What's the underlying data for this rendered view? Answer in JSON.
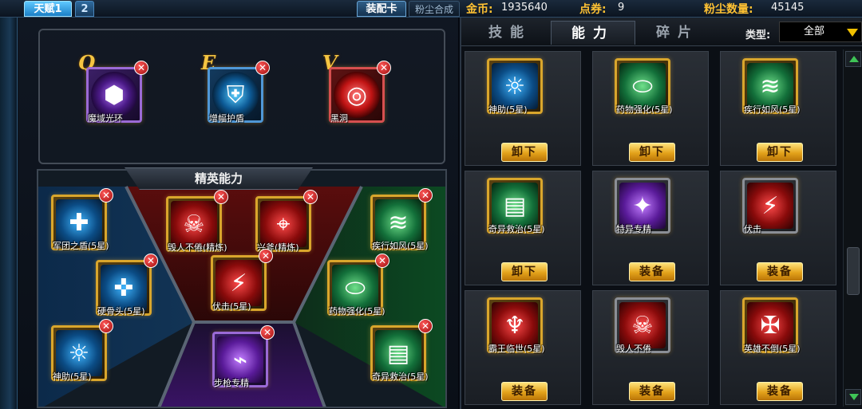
{
  "topbar": {
    "talent_tab_1": "天赋1",
    "talent_tab_2": "2",
    "equip_card_tab": "装配卡",
    "dust_synth_tab": "粉尘合成",
    "gold_label": "金币:",
    "gold_value": "1935640",
    "voucher_label": "点券:",
    "voucher_value": "9",
    "dust_label": "粉尘数量:",
    "dust_value": "45145"
  },
  "hotkeys": [
    {
      "key": "Q",
      "label": "魔域光环",
      "icon": "hexagon-stack-icon",
      "color": "#7b3bd6"
    },
    {
      "key": "E",
      "label": "增幅护盾",
      "icon": "shield-sword-icon",
      "color": "#1f8fd6"
    },
    {
      "key": "V",
      "label": "黑洞",
      "icon": "vortex-icon",
      "color": "#e01f1f"
    }
  ],
  "elite": {
    "title": "精英能力",
    "slots": [
      {
        "label": "军团之盾(5星)",
        "icon": "shield-plus-icon",
        "color": "blue"
      },
      {
        "label": "硬骨头(5星)",
        "icon": "bone-icon",
        "color": "blue"
      },
      {
        "label": "神助(5星)",
        "icon": "divine-aid-icon",
        "color": "blue"
      },
      {
        "label": "毁人不倦(精炼)",
        "icon": "skulls-icon",
        "color": "red"
      },
      {
        "label": "兴斧(精炼)",
        "icon": "rifle-icon",
        "color": "red"
      },
      {
        "label": "伏击(5星)",
        "icon": "shark-icon",
        "color": "red"
      },
      {
        "label": "步枪专精",
        "icon": "gun-icon",
        "color": "purple"
      },
      {
        "label": "疾行如风(5星)",
        "icon": "tornado-icon",
        "color": "green"
      },
      {
        "label": "药物强化(5星)",
        "icon": "pill-icon",
        "color": "green"
      },
      {
        "label": "奇异救治(5星)",
        "icon": "bandage-icon",
        "color": "green"
      }
    ]
  },
  "right": {
    "tabs": [
      "技能",
      "能力",
      "碎片"
    ],
    "active_tab": "能力",
    "type_label": "类型:",
    "type_value": "全部",
    "items": [
      {
        "label": "神助(5星)",
        "icon": "divine-aid-icon",
        "color": "blue",
        "button": "卸下"
      },
      {
        "label": "药物强化(5星)",
        "icon": "pill-icon",
        "color": "green",
        "button": "卸下"
      },
      {
        "label": "疾行如风(5星)",
        "icon": "tornado-icon",
        "color": "green",
        "button": "卸下"
      },
      {
        "label": "奇异救治(5星)",
        "icon": "bandage-icon",
        "color": "green",
        "button": "卸下"
      },
      {
        "label": "特异专精",
        "icon": "special-mastery-icon",
        "color": "purple",
        "button": "装备"
      },
      {
        "label": "伏击",
        "icon": "shark-icon",
        "color": "red",
        "button": "装备"
      },
      {
        "label": "霸王临世(5星)",
        "icon": "claw-icon",
        "color": "red",
        "button": "装备"
      },
      {
        "label": "毁人不倦",
        "icon": "skulls-icon",
        "color": "red",
        "button": "装备"
      },
      {
        "label": "英雄不倒(5星)",
        "icon": "hero-cross-icon",
        "color": "red",
        "button": "装备"
      }
    ]
  }
}
